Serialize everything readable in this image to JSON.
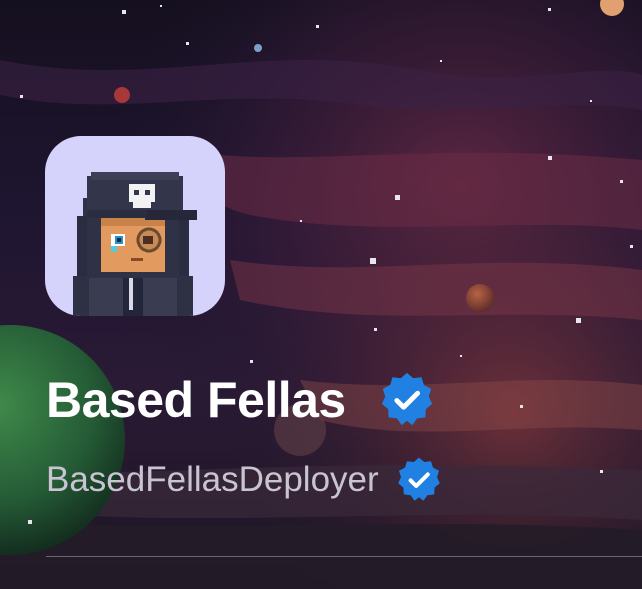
{
  "collection": {
    "name": "Based Fellas",
    "creator": "BasedFellasDeployer",
    "collection_verified": true,
    "creator_verified": true
  },
  "colors": {
    "verified_badge": "#2081e2",
    "avatar_background": "#d5d2fb",
    "title_text": "#ffffff",
    "creator_text": "#c9c4d1"
  },
  "icons": {
    "collection_badge": "verified-badge-icon",
    "creator_badge": "verified-badge-icon"
  }
}
